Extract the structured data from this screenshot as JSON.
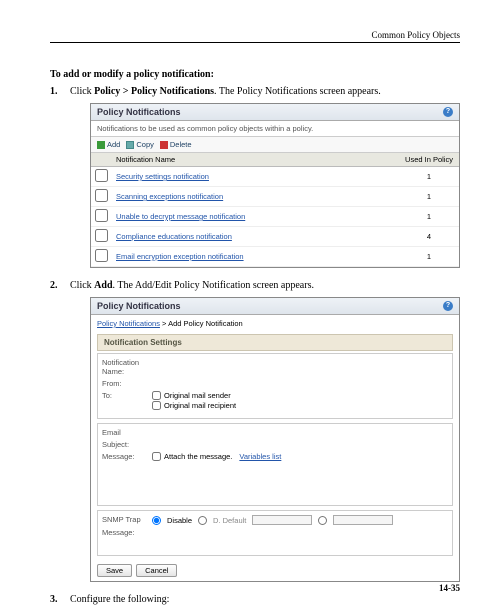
{
  "header": {
    "chapter_title": "Common Policy Objects"
  },
  "section": {
    "heading": "To add or modify a policy notification:"
  },
  "steps": {
    "s1": {
      "prefix": "Click ",
      "bold": "Policy > Policy Notifications",
      "suffix": ". The Policy Notifications screen appears."
    },
    "s2": {
      "prefix": "Click ",
      "bold": "Add",
      "suffix": ". The Add/Edit Policy Notification screen appears."
    },
    "s3": {
      "text": "Configure the following:"
    }
  },
  "panel1": {
    "title": "Policy Notifications",
    "subtitle": "Notifications to be used as common policy objects within a policy.",
    "toolbar": {
      "add": "Add",
      "copy": "Copy",
      "delete": "Delete"
    },
    "columns": {
      "name": "Notification Name",
      "used": "Used In Policy"
    },
    "rows": [
      {
        "name": "Security settings notification",
        "used": "1"
      },
      {
        "name": "Scanning exceptions notification",
        "used": "1"
      },
      {
        "name": "Unable to decrypt message notification",
        "used": "1"
      },
      {
        "name": "Compliance educations notification",
        "used": "4"
      },
      {
        "name": "Email encryption exception notification",
        "used": "1"
      }
    ]
  },
  "panel2": {
    "title": "Policy Notifications",
    "breadcrumb": {
      "root": "Policy Notifications",
      "sep": " > ",
      "current": "Add Policy Notification"
    },
    "sub": "Notification Settings",
    "labels": {
      "name": "Notification Name:",
      "from": "From:",
      "to": "To:",
      "orig_sender": "Original mail sender",
      "orig_recipient": "Original mail recipient",
      "email": "Email",
      "subject": "Subject:",
      "message": "Message:",
      "attach": "Attach the message.",
      "varlist": "Variables list",
      "snmp": "SNMP Trap",
      "disable": "Disable",
      "default_opt": "D. Default"
    },
    "buttons": {
      "save": "Save",
      "cancel": "Cancel"
    }
  },
  "footer": {
    "page": "14-35"
  }
}
